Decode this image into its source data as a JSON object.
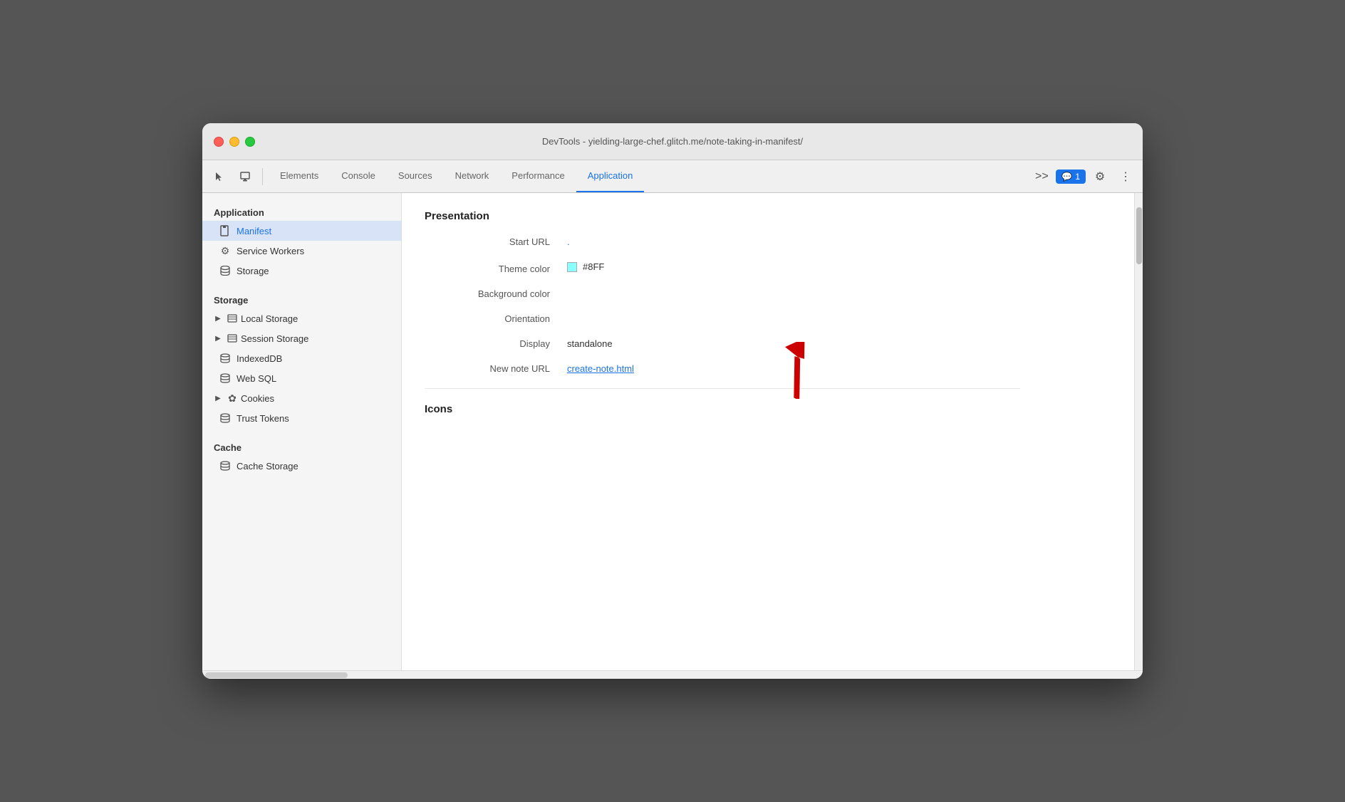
{
  "window": {
    "title": "DevTools - yielding-large-chef.glitch.me/note-taking-in-manifest/"
  },
  "toolbar": {
    "tabs": [
      {
        "id": "elements",
        "label": "Elements",
        "active": false
      },
      {
        "id": "console",
        "label": "Console",
        "active": false
      },
      {
        "id": "sources",
        "label": "Sources",
        "active": false
      },
      {
        "id": "network",
        "label": "Network",
        "active": false
      },
      {
        "id": "performance",
        "label": "Performance",
        "active": false
      },
      {
        "id": "application",
        "label": "Application",
        "active": true
      }
    ],
    "more_label": ">>",
    "chat_count": "1",
    "chat_icon": "💬"
  },
  "sidebar": {
    "application_section": "Application",
    "application_items": [
      {
        "id": "manifest",
        "label": "Manifest",
        "icon": "📄",
        "active": true
      },
      {
        "id": "service-workers",
        "label": "Service Workers",
        "icon": "⚙️",
        "active": false
      },
      {
        "id": "storage",
        "label": "Storage",
        "icon": "🗄️",
        "active": false
      }
    ],
    "storage_section": "Storage",
    "storage_items": [
      {
        "id": "local-storage",
        "label": "Local Storage",
        "icon": "⊞",
        "has_arrow": true
      },
      {
        "id": "session-storage",
        "label": "Session Storage",
        "icon": "⊞",
        "has_arrow": true
      },
      {
        "id": "indexed-db",
        "label": "IndexedDB",
        "icon": "🗄️",
        "has_arrow": false
      },
      {
        "id": "web-sql",
        "label": "Web SQL",
        "icon": "🗄️",
        "has_arrow": false
      },
      {
        "id": "cookies",
        "label": "Cookies",
        "icon": "✿",
        "has_arrow": true
      },
      {
        "id": "trust-tokens",
        "label": "Trust Tokens",
        "icon": "🗄️",
        "has_arrow": false
      }
    ],
    "cache_section": "Cache",
    "cache_items": [
      {
        "id": "cache-storage",
        "label": "Cache Storage",
        "icon": "🗄️",
        "has_arrow": false
      }
    ]
  },
  "content": {
    "presentation_title": "Presentation",
    "fields": [
      {
        "id": "start-url",
        "label": "Start URL",
        "value": ".",
        "type": "dot"
      },
      {
        "id": "theme-color",
        "label": "Theme color",
        "value": "#8FF",
        "swatch": "#8FF",
        "type": "swatch"
      },
      {
        "id": "background-color",
        "label": "Background color",
        "value": "",
        "type": "empty"
      },
      {
        "id": "orientation",
        "label": "Orientation",
        "value": "",
        "type": "empty"
      },
      {
        "id": "display",
        "label": "Display",
        "value": "standalone",
        "type": "text"
      },
      {
        "id": "new-note-url",
        "label": "New note URL",
        "value": "create-note.html",
        "type": "link"
      }
    ],
    "icons_title": "Icons"
  }
}
